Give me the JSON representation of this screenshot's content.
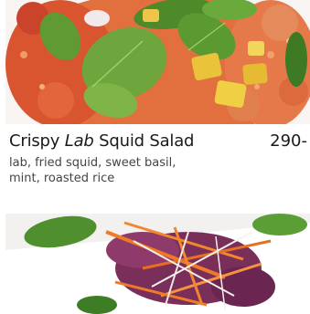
{
  "menu_item": {
    "title_before": "Crispy ",
    "title_italic": "Lab",
    "title_after": " Squid Salad",
    "price": "290-",
    "description_lines": [
      "lab, fried squid, sweet basil,",
      "mint, roasted rice"
    ]
  },
  "photos": [
    {
      "name": "crispy-lab-squid-salad-photo"
    },
    {
      "name": "slaw-salad-photo"
    }
  ],
  "colors": {
    "text": "#1a1a1a",
    "description": "#444444",
    "background": "#ffffff"
  }
}
